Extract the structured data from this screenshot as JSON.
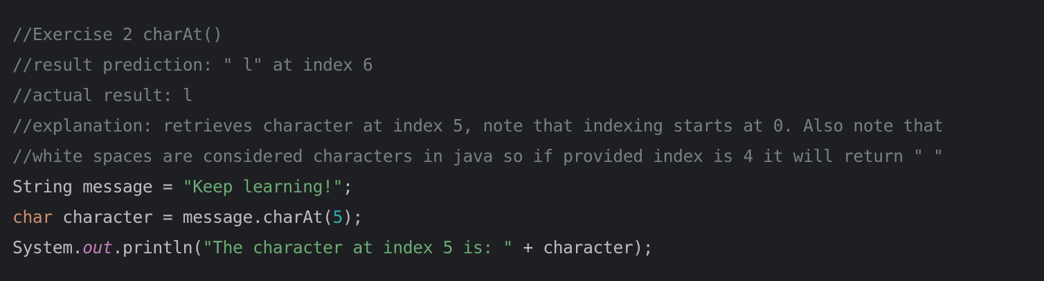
{
  "colors": {
    "background": "#1e1f22",
    "default_text": "#bcbec4",
    "comment": "#7a7e85",
    "keyword": "#cf8e6d",
    "string": "#6aab73",
    "number": "#2aacb8",
    "static_field": "#c77dbb"
  },
  "code": {
    "comment_1": "//Exercise 2 charAt()",
    "comment_2": "//result prediction: \" l\" at index 6",
    "comment_3": "//actual result: l",
    "comment_4": "//explanation: retrieves character at index 5, note that indexing starts at 0. Also note that",
    "comment_5": "//white spaces are considered characters in java so if provided index is 4 it will return \" \"",
    "line_6": {
      "t1": "String message = ",
      "t2": "\"Keep learning!\"",
      "t3": ";"
    },
    "line_7": {
      "t1": "char",
      "t2": " character = message.charAt(",
      "t3": "5",
      "t4": ");"
    },
    "line_8": {
      "t1": "System.",
      "t2": "out",
      "t3": ".println(",
      "t4": "\"The character at index 5 is: \"",
      "t5": " + character);"
    }
  }
}
